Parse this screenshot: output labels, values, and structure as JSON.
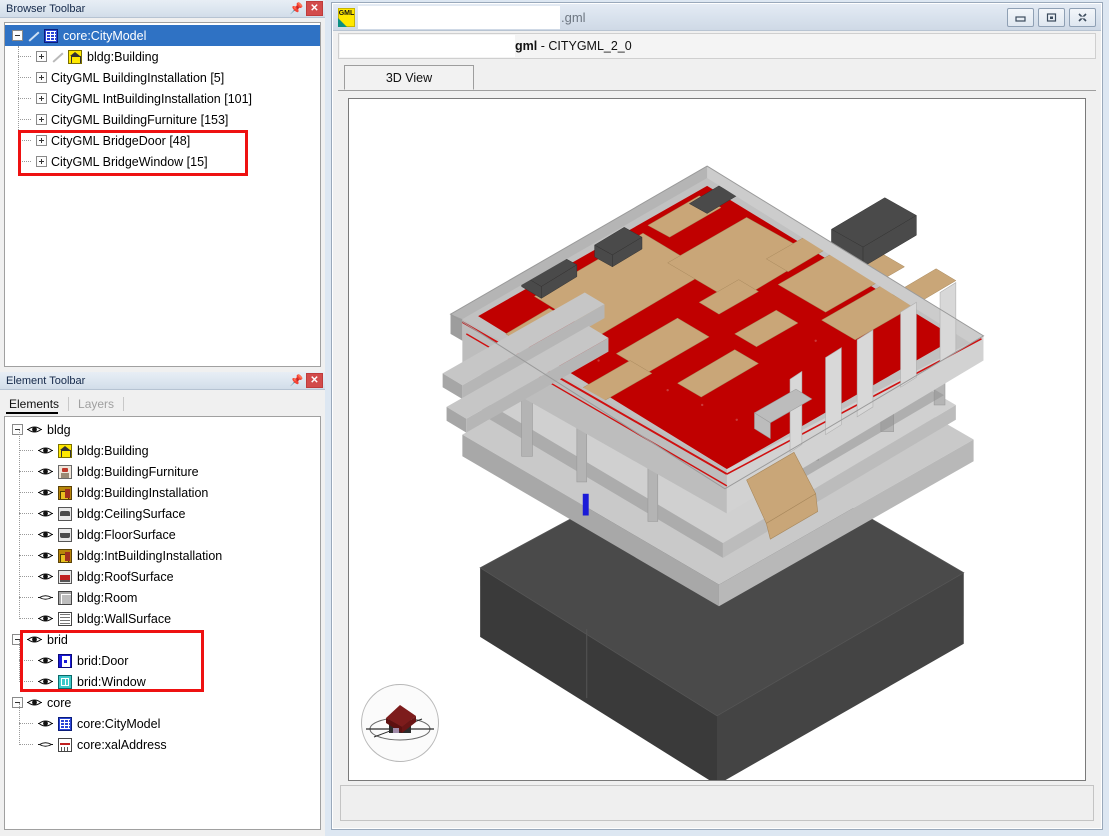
{
  "browser_panel": {
    "title": "Browser Toolbar",
    "pin_icon": "pin-icon",
    "close_label": "✕",
    "tree": [
      {
        "label": "core:CityModel",
        "indent": 0,
        "expander": "minus",
        "icon": "citymodel-icon",
        "pencil": true,
        "selected": true
      },
      {
        "label": "bldg:Building",
        "indent": 1,
        "expander": "plus",
        "icon": "building-icon",
        "pencil": true,
        "selected": false
      },
      {
        "label": "CityGML BuildingInstallation [5]",
        "indent": 1,
        "expander": "plus",
        "icon": null,
        "pencil": false,
        "selected": false
      },
      {
        "label": "CityGML IntBuildingInstallation [101]",
        "indent": 1,
        "expander": "plus",
        "icon": null,
        "pencil": false,
        "selected": false
      },
      {
        "label": "CityGML BuildingFurniture [153]",
        "indent": 1,
        "expander": "plus",
        "icon": null,
        "pencil": false,
        "selected": false
      },
      {
        "label": "CityGML BridgeDoor [48]",
        "indent": 1,
        "expander": "plus",
        "icon": null,
        "pencil": false,
        "selected": false
      },
      {
        "label": "CityGML BridgeWindow [15]",
        "indent": 1,
        "expander": "plus",
        "icon": null,
        "pencil": false,
        "selected": false
      }
    ]
  },
  "element_panel": {
    "title": "Element Toolbar",
    "pin_icon": "pin-icon",
    "close_label": "✕",
    "tabs": [
      {
        "label": "Elements",
        "active": true
      },
      {
        "label": "Layers",
        "active": false
      }
    ],
    "tree": [
      {
        "label": "bldg",
        "indent": 0,
        "expander": "minus",
        "eye": "visible",
        "icon": null
      },
      {
        "label": "bldg:Building",
        "indent": 1,
        "expander": null,
        "eye": "visible",
        "icon": "building-icon"
      },
      {
        "label": "bldg:BuildingFurniture",
        "indent": 1,
        "expander": null,
        "eye": "visible",
        "icon": "furniture-icon"
      },
      {
        "label": "bldg:BuildingInstallation",
        "indent": 1,
        "expander": null,
        "eye": "visible",
        "icon": "installation-icon"
      },
      {
        "label": "bldg:CeilingSurface",
        "indent": 1,
        "expander": null,
        "eye": "visible",
        "icon": "ceiling-icon"
      },
      {
        "label": "bldg:FloorSurface",
        "indent": 1,
        "expander": null,
        "eye": "visible",
        "icon": "floor-icon"
      },
      {
        "label": "bldg:IntBuildingInstallation",
        "indent": 1,
        "expander": null,
        "eye": "visible",
        "icon": "installation-icon"
      },
      {
        "label": "bldg:RoofSurface",
        "indent": 1,
        "expander": null,
        "eye": "visible",
        "icon": "roof-icon"
      },
      {
        "label": "bldg:Room",
        "indent": 1,
        "expander": null,
        "eye": "hidden",
        "icon": "room-icon"
      },
      {
        "label": "bldg:WallSurface",
        "indent": 1,
        "expander": null,
        "eye": "visible",
        "icon": "wall-icon"
      },
      {
        "label": "brid",
        "indent": 0,
        "expander": "minus",
        "eye": "visible",
        "icon": null
      },
      {
        "label": "brid:Door",
        "indent": 1,
        "expander": null,
        "eye": "visible",
        "icon": "door-icon"
      },
      {
        "label": "brid:Window",
        "indent": 1,
        "expander": null,
        "eye": "visible",
        "icon": "window-icon"
      },
      {
        "label": "core",
        "indent": 0,
        "expander": "minus",
        "eye": "visible",
        "icon": null
      },
      {
        "label": "core:CityModel",
        "indent": 1,
        "expander": null,
        "eye": "visible",
        "icon": "citymodel-icon"
      },
      {
        "label": "core:xalAddress",
        "indent": 1,
        "expander": null,
        "eye": "hidden",
        "icon": "xaladdress-icon"
      }
    ]
  },
  "main_window": {
    "app_icon_label": "GML",
    "title_suffix": ".gml",
    "subtitle_prefix": "gml",
    "subtitle_sep": " - ",
    "subtitle_value": "CITYGML_2_0",
    "controls": [
      {
        "name": "minimize-button",
        "glyph": "minimize-icon"
      },
      {
        "name": "restore-button",
        "glyph": "restore-icon"
      },
      {
        "name": "close-button",
        "glyph": "close-icon"
      }
    ],
    "tabs": [
      {
        "label": "3D View",
        "active": true
      }
    ],
    "viewport": {
      "nav_widget": "navigation-cube-icon",
      "model_description": "CityGML 3D building model with terrain base"
    }
  },
  "annotations": {
    "accent_color": "#ee1111",
    "boxes": [
      {
        "name": "browser-bridge-highlight"
      },
      {
        "name": "element-brid-highlight"
      }
    ]
  }
}
